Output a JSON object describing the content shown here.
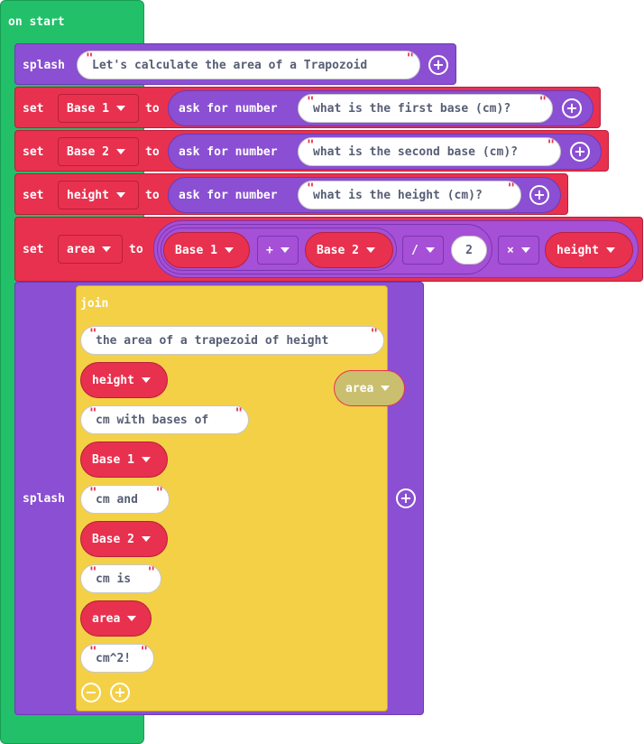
{
  "colors": {
    "events": "#22c068",
    "splash": "#8a4fd2",
    "variables": "#e8314f",
    "text": "#f4d046",
    "math": "#a550d6"
  },
  "on_start": {
    "label": "on start"
  },
  "splash1": {
    "label": "splash",
    "text": "Let's calculate the area of a Trapozoid"
  },
  "set_base1": {
    "set": "set",
    "var": "Base 1",
    "to": "to",
    "ask": "ask for number",
    "prompt": "what is the first base (cm)?"
  },
  "set_base2": {
    "set": "set",
    "var": "Base 2",
    "to": "to",
    "ask": "ask for number",
    "prompt": "what is the second base (cm)?"
  },
  "set_height": {
    "set": "set",
    "var": "height",
    "to": "to",
    "ask": "ask for number",
    "prompt": "what is the height (cm)?"
  },
  "set_area": {
    "set": "set",
    "var": "area",
    "to": "to",
    "a": "Base 1",
    "op1": "+",
    "b": "Base 2",
    "op2": "/",
    "n": "2",
    "op3": "×",
    "c": "height"
  },
  "splash2": {
    "label": "splash",
    "join": {
      "label": "join",
      "items": [
        {
          "type": "string",
          "text": "the area of a trapezoid of height "
        },
        {
          "type": "var",
          "text": "height"
        },
        {
          "type": "string",
          "text": "cm with bases of "
        },
        {
          "type": "var",
          "text": "Base 1"
        },
        {
          "type": "string",
          "text": "cm and "
        },
        {
          "type": "var",
          "text": "Base 2"
        },
        {
          "type": "string",
          "text": "cm is "
        },
        {
          "type": "var",
          "text": "area"
        },
        {
          "type": "string",
          "text": "cm^2!"
        }
      ]
    },
    "ghost_var": "area"
  },
  "icons": {
    "plus": "plus-circle-icon",
    "minus": "minus-circle-icon",
    "dropdown": "dropdown-arrow-icon"
  }
}
